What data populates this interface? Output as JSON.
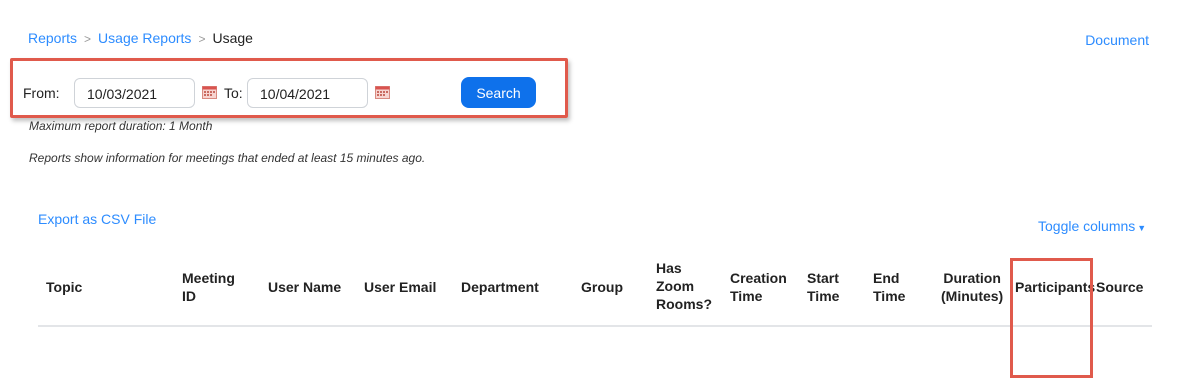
{
  "breadcrumb": {
    "item1": "Reports",
    "item2": "Usage Reports",
    "current": "Usage",
    "sep": ">"
  },
  "document_link": "Document",
  "date_range": {
    "from_label": "From:",
    "from_value": "10/03/2021",
    "to_label": "To:",
    "to_value": "10/04/2021",
    "search_label": "Search"
  },
  "notes": {
    "max_duration": "Maximum report duration: 1 Month",
    "info": "Reports show information for meetings that ended at least 15 minutes ago."
  },
  "actions": {
    "export": "Export as CSV File",
    "toggle_columns": "Toggle columns"
  },
  "table": {
    "headers": {
      "topic": "Topic",
      "meeting_id_1": "Meeting",
      "meeting_id_2": "ID",
      "user_name": "User Name",
      "user_email": "User Email",
      "department": "Department",
      "group": "Group",
      "has_zoom_1": "Has",
      "has_zoom_2": "Zoom",
      "has_zoom_3": "Rooms?",
      "creation_1": "Creation",
      "creation_2": "Time",
      "start_1": "Start",
      "start_2": "Time",
      "end_1": "End",
      "end_2": "Time",
      "duration_1": "Duration",
      "duration_2": "(Minutes)",
      "participants": "Participants",
      "source": "Source"
    }
  },
  "colors": {
    "link": "#2d8cff",
    "button": "#0e71eb",
    "highlight": "#e05a4c"
  }
}
